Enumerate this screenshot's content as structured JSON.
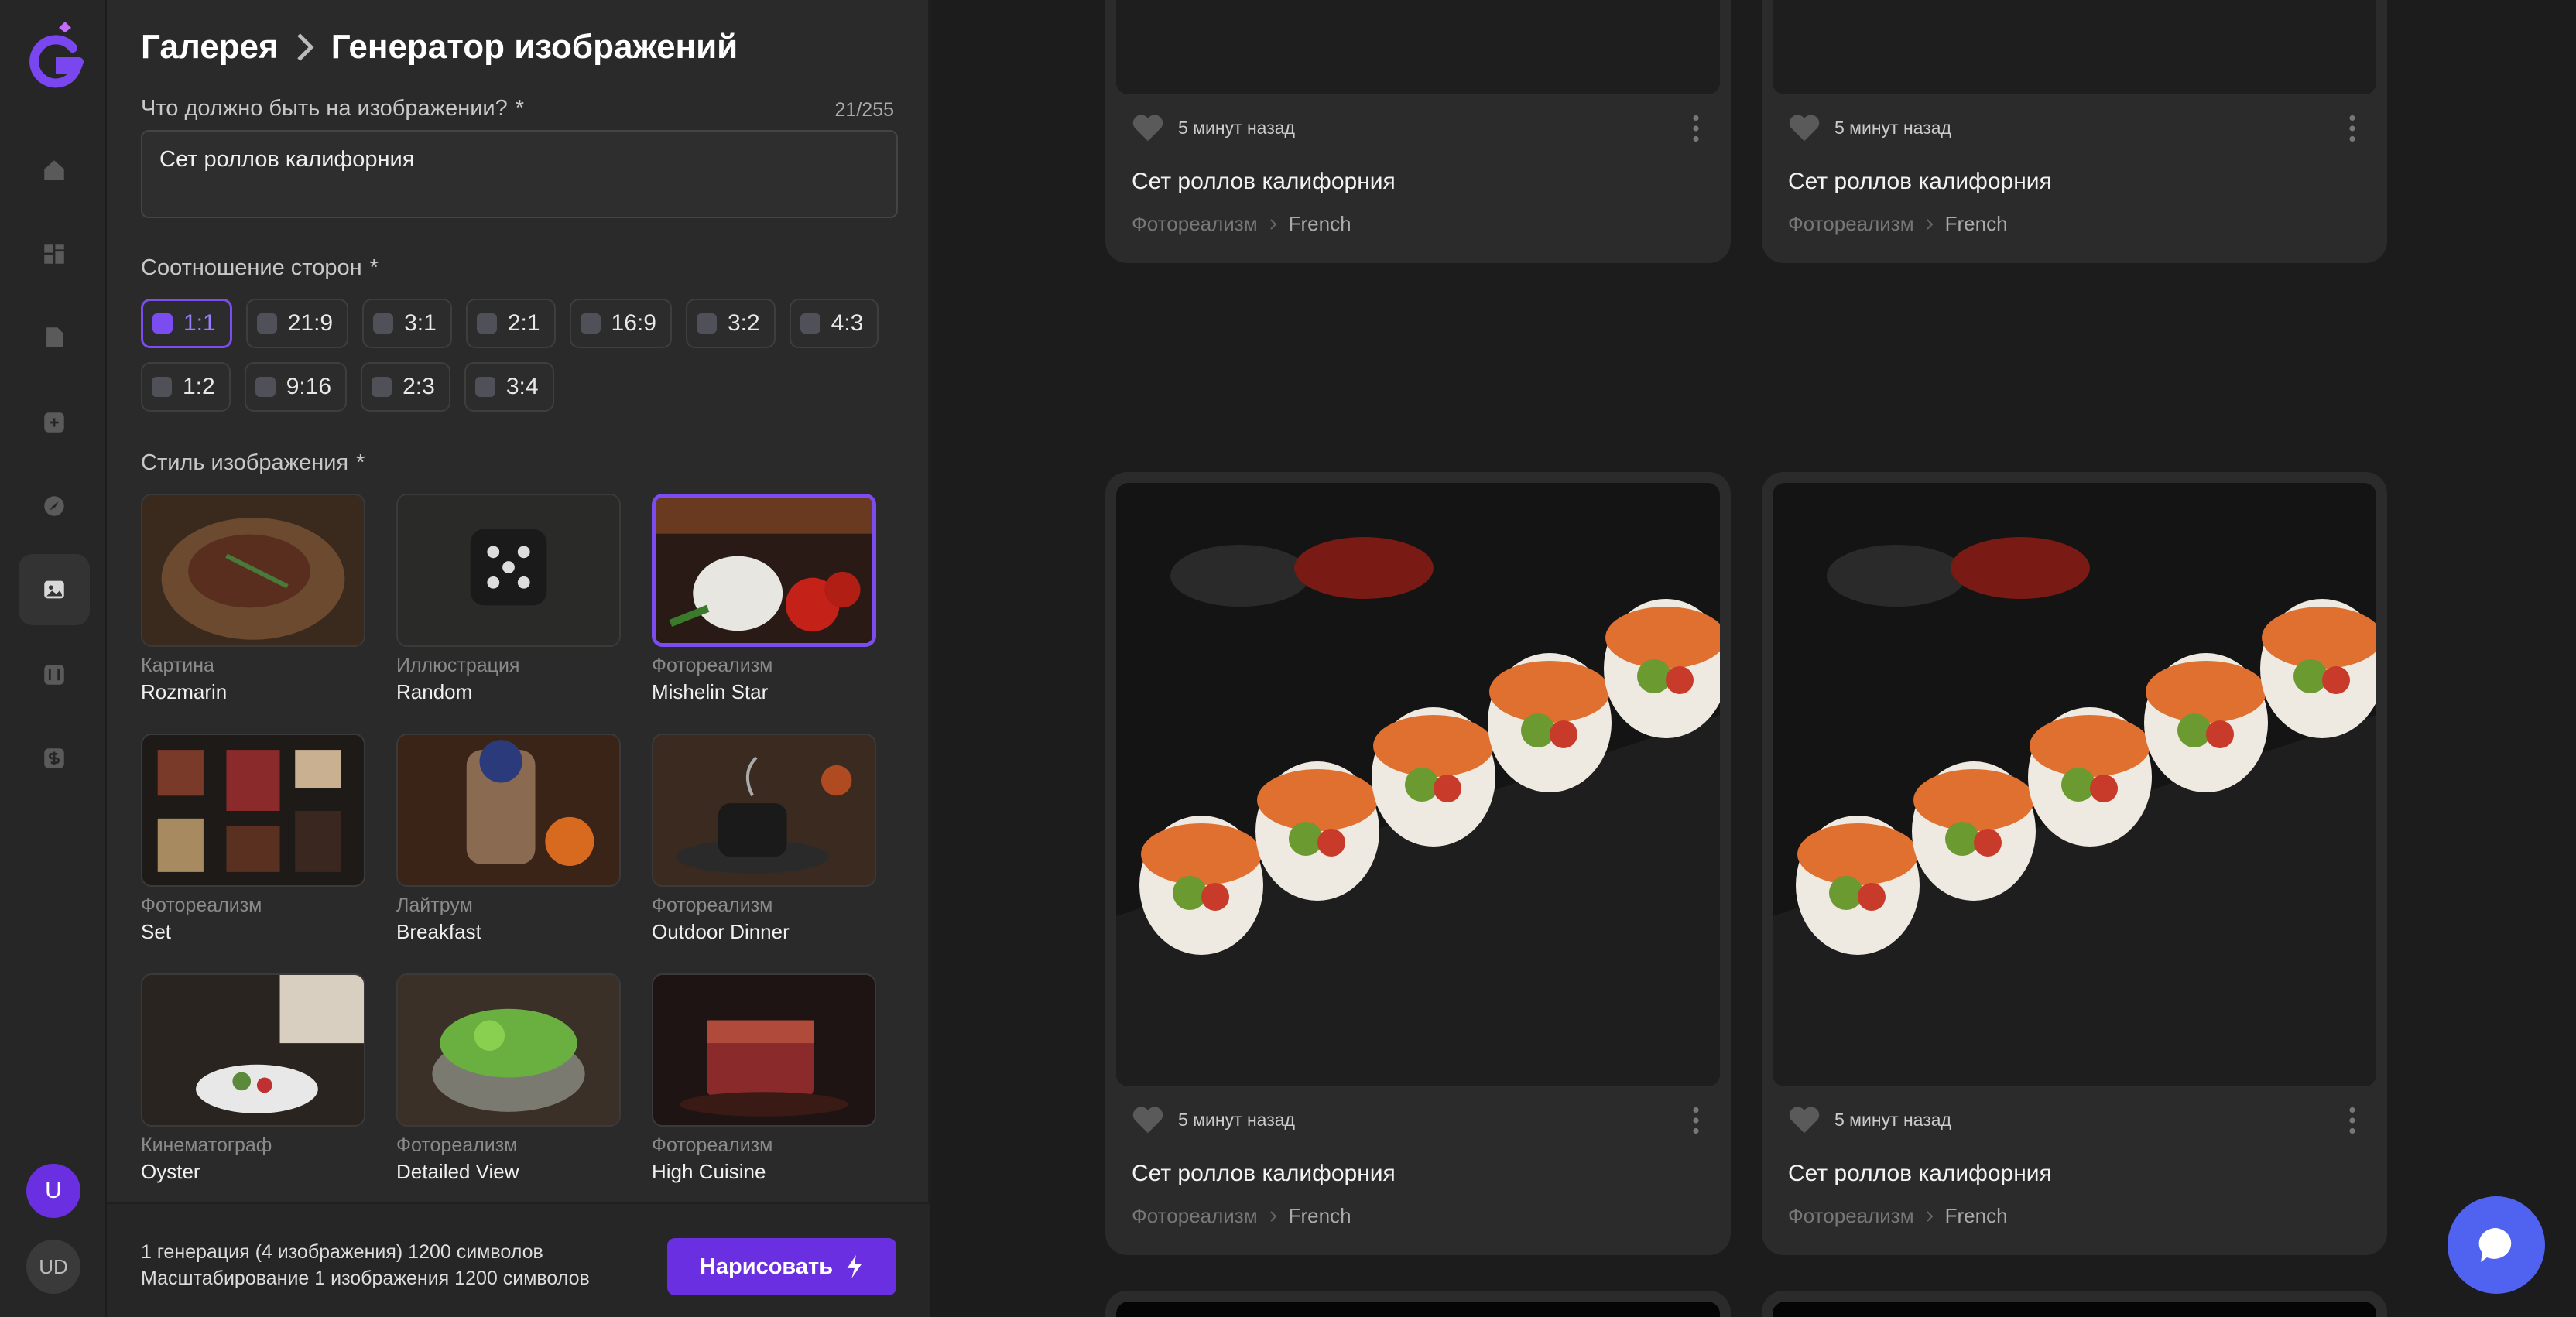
{
  "breadcrumb": {
    "parent": "Галерея",
    "current": "Генератор изображений"
  },
  "prompt": {
    "label": "Что должно быть на изображении?",
    "required_mark": "*",
    "counter": "21/255",
    "value": "Сет роллов калифорния"
  },
  "aspect": {
    "label": "Соотношение сторон",
    "required_mark": "*",
    "selected": "1:1",
    "options": [
      "1:1",
      "21:9",
      "3:1",
      "2:1",
      "16:9",
      "3:2",
      "4:3",
      "1:2",
      "9:16",
      "2:3",
      "3:4"
    ]
  },
  "styles": {
    "label": "Стиль изображения",
    "required_mark": "*",
    "selected": "Mishelin Star",
    "items": [
      {
        "category": "Картина",
        "name": "Rozmarin"
      },
      {
        "category": "Иллюстрация",
        "name": "Random"
      },
      {
        "category": "Фотореализм",
        "name": "Mishelin Star"
      },
      {
        "category": "Фотореализм",
        "name": "Set"
      },
      {
        "category": "Лайтрум",
        "name": "Breakfast"
      },
      {
        "category": "Фотореализм",
        "name": "Outdoor Dinner"
      },
      {
        "category": "Кинематограф",
        "name": "Oyster"
      },
      {
        "category": "Фотореализм",
        "name": "Detailed View"
      },
      {
        "category": "Фотореализм",
        "name": "High Cuisine"
      }
    ]
  },
  "footer": {
    "line1": "1 генерация (4 изображения) 1200 символов",
    "line2": "Масштабирование 1 изображения 1200 символов",
    "draw_button": "Нарисовать"
  },
  "user": {
    "avatar_initial": "U",
    "avatar_initials": "UD"
  },
  "gallery": {
    "cards": [
      {
        "time": "5 минут назад",
        "title": "Сет роллов калифорния",
        "tag_style": "Фотореализм",
        "tag_sub": "French"
      },
      {
        "time": "5 минут назад",
        "title": "Сет роллов калифорния",
        "tag_style": "Фотореализм",
        "tag_sub": "French"
      },
      {
        "time": "5 минут назад",
        "title": "Сет роллов калифорния",
        "tag_style": "Фотореализм",
        "tag_sub": "French"
      },
      {
        "time": "5 минут назад",
        "title": "Сет роллов калифорния",
        "tag_style": "Фотореализм",
        "tag_sub": "French"
      }
    ]
  },
  "colors": {
    "accent": "#6a2fe0",
    "chat_button": "#4f62f0"
  }
}
